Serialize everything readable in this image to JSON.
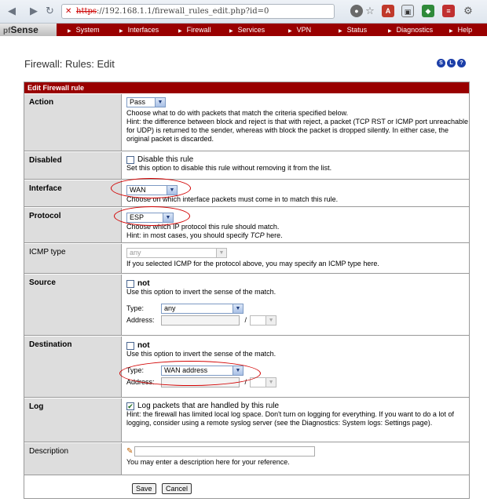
{
  "browser": {
    "url_https": "https",
    "url_rest": "://192.168.1.1/firewall_rules_edit.php?id=0"
  },
  "menu": {
    "logo": "Sense",
    "logo_prefix": "pf",
    "items": [
      "System",
      "Interfaces",
      "Firewall",
      "Services",
      "VPN",
      "Status",
      "Diagnostics",
      "Help"
    ]
  },
  "page_title": "Firewall: Rules: Edit",
  "table_header": "Edit Firewall rule",
  "action": {
    "label": "Action",
    "value": "Pass",
    "desc1": "Choose what to do with packets that match the criteria specified below.",
    "desc2": "Hint: the difference between block and reject is that with reject, a packet (TCP RST or ICMP port unreachable for UDP) is returned to the sender, whereas with block the packet is dropped silently. In either case, the original packet is discarded."
  },
  "disabled": {
    "label": "Disabled",
    "check_label": "Disable this rule",
    "desc": "Set this option to disable this rule without removing it from the list."
  },
  "interface": {
    "label": "Interface",
    "value": "WAN",
    "desc": "Choose on which interface packets must come in to match this rule."
  },
  "protocol": {
    "label": "Protocol",
    "value": "ESP",
    "desc1": "Choose which IP protocol this rule should match.",
    "desc2_pre": "Hint: in most cases, you should specify ",
    "desc2_em": "TCP",
    "desc2_post": " here."
  },
  "icmp": {
    "label": "ICMP type",
    "value": "any",
    "desc": "If you selected ICMP for the protocol above, you may specify an ICMP type here."
  },
  "source": {
    "label": "Source",
    "not_label": "not",
    "desc": "Use this option to invert the sense of the match.",
    "type_label": "Type:",
    "type_value": "any",
    "address_label": "Address:",
    "slash": "/"
  },
  "destination": {
    "label": "Destination",
    "not_label": "not",
    "desc": "Use this option to invert the sense of the match.",
    "type_label": "Type:",
    "type_value": "WAN address",
    "address_label": "Address:",
    "slash": "/"
  },
  "log": {
    "label": "Log",
    "check_label": "Log packets that are handled by this rule",
    "checked": true,
    "desc": "Hint: the firewall has limited local log space. Don't turn on logging for everything. If you want to do a lot of logging, consider using a remote syslog server (see the Diagnostics: System logs: Settings page)."
  },
  "description": {
    "label": "Description",
    "desc": "You may enter a description here for your reference."
  },
  "buttons": {
    "save": "Save",
    "cancel": "Cancel"
  },
  "colors": {
    "brand": "#990000",
    "label_bg": "#dddddd",
    "highlight_ring": "#d20000"
  }
}
